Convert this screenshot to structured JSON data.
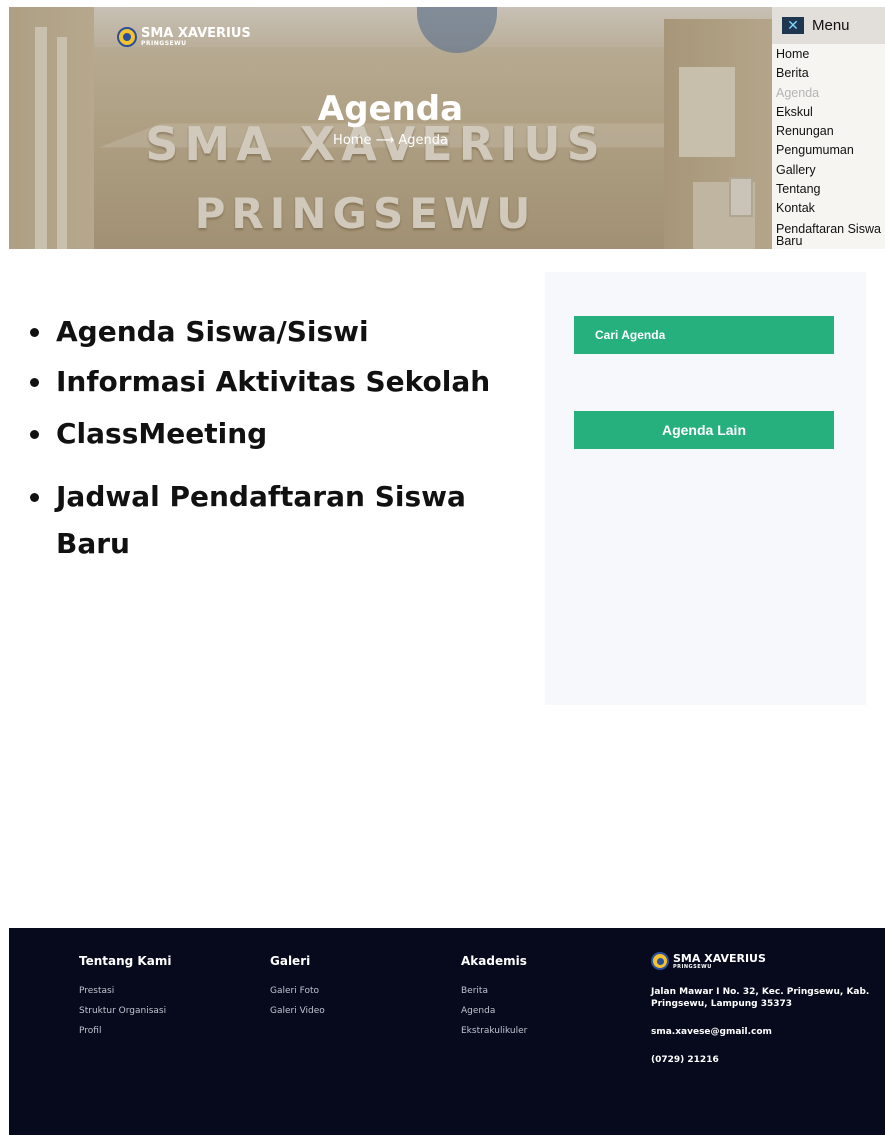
{
  "brand": {
    "name": "SMA XAVERIUS",
    "sub": "PRINGSEWU"
  },
  "hero": {
    "title": "Agenda",
    "breadcrumb": "Home ⟶ Agenda",
    "building_text_1": "SMA XAVERIUS",
    "building_text_2": "PRINGSEWU"
  },
  "menu": {
    "label": "Menu",
    "items": [
      "Home",
      "Berita",
      "Agenda",
      "Ekskul",
      "Renungan",
      "Pengumuman",
      "Gallery",
      "Tentang",
      "Kontak",
      "Pendaftaran Siswa Baru"
    ],
    "active": "Agenda"
  },
  "agenda_items": [
    "Agenda Siswa/Siswi",
    "Informasi Aktivitas Sekolah",
    "ClassMeeting",
    "Jadwal Pendaftaran Siswa Baru"
  ],
  "side": {
    "search_label": "Cari Agenda",
    "other_label": "Agenda Lain"
  },
  "footer": {
    "col1": {
      "title": "Tentang Kami",
      "items": [
        "Prestasi",
        "Struktur Organisasi",
        "Profil"
      ]
    },
    "col2": {
      "title": "Galeri",
      "items": [
        "Galeri Foto",
        "Galeri Video"
      ]
    },
    "col3": {
      "title": "Akademis",
      "items": [
        "Berita",
        "Agenda",
        "Ekstrakulikuler"
      ]
    },
    "contact": {
      "address": "Jalan Mawar I No. 32, Kec. Pringsewu, Kab. Pringsewu, Lampung 35373",
      "email": "sma.xavese@gmail.com",
      "phone": "(0729) 21216"
    }
  },
  "colors": {
    "accent": "#26b07e",
    "footer_bg": "#060a1c"
  }
}
